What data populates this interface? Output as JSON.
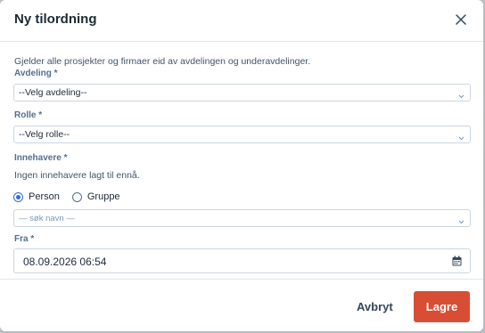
{
  "modal": {
    "title": "Ny tilordning",
    "description": "Gjelder alle prosjekter og firmaer eid av avdelingen og underavdelinger."
  },
  "form": {
    "department": {
      "label": "Avdeling *",
      "value": "--Velg avdeling--"
    },
    "role": {
      "label": "Rolle *",
      "value": "--Velg rolle--"
    },
    "holders": {
      "label": "Innehavere *",
      "empty_text": "Ingen innehavere lagt til ennå.",
      "type_options": [
        {
          "label": "Person",
          "checked": true
        },
        {
          "label": "Gruppe",
          "checked": false
        }
      ],
      "search_placeholder": "— søk navn —"
    },
    "from": {
      "label": "Fra *",
      "value": "08.09.2026 06:54"
    }
  },
  "footer": {
    "cancel_label": "Avbryt",
    "save_label": "Lagre"
  },
  "colors": {
    "primary_button": "#d84e35",
    "radio_accent": "#2c6fd6",
    "label": "#516f90"
  }
}
